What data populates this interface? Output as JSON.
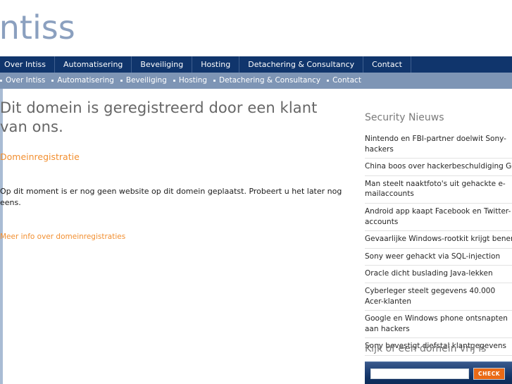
{
  "header": {
    "logo_text": "intiss"
  },
  "nav": {
    "items": [
      {
        "label": "Over Intiss"
      },
      {
        "label": "Automatisering"
      },
      {
        "label": "Beveiliging"
      },
      {
        "label": "Hosting"
      },
      {
        "label": "Detachering & Consultancy"
      },
      {
        "label": "Contact"
      }
    ]
  },
  "breadcrumb": {
    "items": [
      {
        "label": "Over Intiss"
      },
      {
        "label": "Automatisering"
      },
      {
        "label": "Beveiliging"
      },
      {
        "label": "Hosting"
      },
      {
        "label": "Detachering & Consultancy"
      },
      {
        "label": "Contact"
      }
    ]
  },
  "main": {
    "title": "Dit domein is geregistreerd door een klant van ons.",
    "primary_link": "Domeinregistratie",
    "body": "Op dit moment is er nog geen website op dit domein geplaatst. Probeert u het later nog eens.",
    "secondary_link": "Meer info over domeinregistraties"
  },
  "sidebar": {
    "news_title": "Security Nieuws",
    "news_items": [
      {
        "label": "Nintendo en FBI-partner doelwit Sony-hackers"
      },
      {
        "label": "China boos over hackerbeschuldiging Google"
      },
      {
        "label": "Man steelt naaktfoto's uit gehackte e-mailaccounts"
      },
      {
        "label": "Android app kaapt Facebook en Twitter-accounts"
      },
      {
        "label": "Gevaarlijke Windows-rootkit krijgt benen"
      },
      {
        "label": "Sony weer gehackt via SQL-injection"
      },
      {
        "label": "Oracle dicht buslading Java-lekken"
      },
      {
        "label": "Cyberleger steelt gegevens 40.000 Acer-klanten"
      },
      {
        "label": "Google en Windows phone ontsnapten aan hackers"
      },
      {
        "label": "Sony bevestigt diefstal klantgegevens"
      }
    ]
  },
  "domain_check": {
    "title": "Kijk of een domein vrij is",
    "input_value": "",
    "input_placeholder": "",
    "button_label": "CHECK"
  },
  "colors": {
    "nav_bg": "#10356c",
    "breadcrumb_bg": "#7e95b5",
    "logo": "#8ba0bf",
    "accent_orange": "#f28f30",
    "button_orange": "#ea6a16",
    "title_grey": "#666666"
  }
}
